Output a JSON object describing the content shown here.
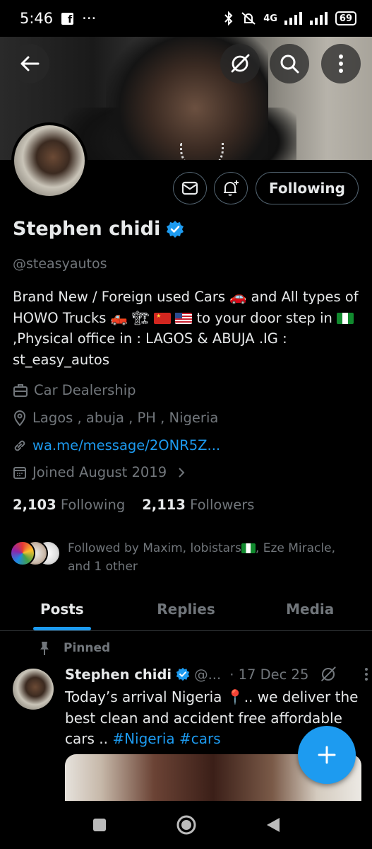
{
  "status_bar": {
    "time": "5:46",
    "fb_badge": "f",
    "more": "···",
    "network": "4G",
    "battery": "69"
  },
  "banner": {
    "back_icon": "arrow-left-icon",
    "grok_icon": "slash-circle-icon",
    "search_icon": "search-icon",
    "more_icon": "more-vertical-icon"
  },
  "actions": {
    "message_icon": "envelope-icon",
    "notify_icon": "bell-plus-icon",
    "following_label": "Following"
  },
  "profile": {
    "name": "Stephen chidi",
    "verified": true,
    "handle": "@steasyautos",
    "bio_1": "Brand New / Foreign used Cars 🚗 and All types of HOWO Trucks 🛻 🏗",
    "bio_2": "to your door step in",
    "bio_3": ",Physical office in : LAGOS & ABUJA .IG : st_easy_autos",
    "category": "Car Dealership",
    "location": "Lagos , abuja , PH , Nigeria",
    "link": "wa.me/message/2ONR5Z...",
    "joined": "Joined August 2019",
    "following_count": "2,103",
    "following_label": "Following",
    "followers_count": "2,113",
    "followers_label": "Followers",
    "followed_by_1": "Followed by Maxim, lobistars",
    "followed_by_2": ", Eze Miracle, and 1 other"
  },
  "tabs": [
    {
      "label": "Posts",
      "active": true
    },
    {
      "label": "Replies",
      "active": false
    },
    {
      "label": "Media",
      "active": false
    }
  ],
  "tweet": {
    "pinned_label": "Pinned",
    "name": "Stephen chidi",
    "handle_short": "@...",
    "date": "· 17 Dec 25",
    "text_1": "Today’s arrival Nigeria 📍.. we deliver the best clean and accident free affordable cars ..",
    "hashtag_1": "#Nigeria",
    "hashtag_2": "#cars"
  },
  "colors": {
    "accent": "#1d9bf0",
    "muted": "#71767b",
    "text": "#e7e9ea",
    "border": "#2f3336"
  }
}
